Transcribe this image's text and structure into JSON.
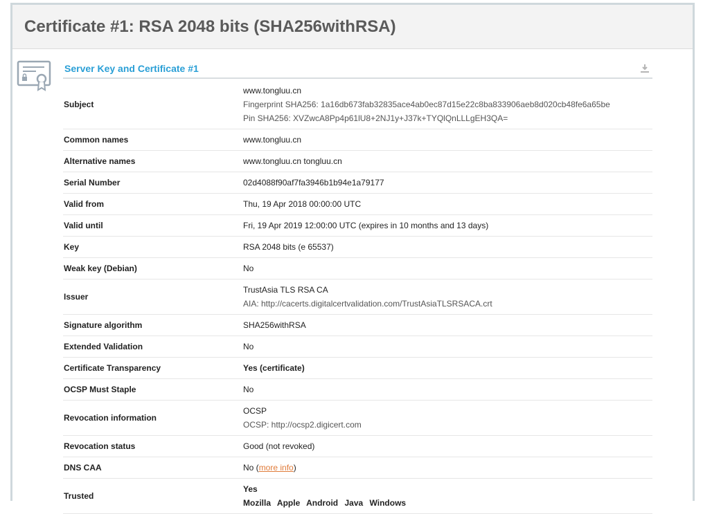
{
  "header": {
    "title": "Certificate #1: RSA 2048 bits (SHA256withRSA)"
  },
  "section": {
    "title": "Server Key and Certificate #1",
    "download_icon": "download-icon"
  },
  "rows": {
    "subject": {
      "label": "Subject",
      "value": "www.tongluu.cn",
      "fingerprint": "Fingerprint SHA256: 1a16db673fab32835ace4ab0ec87d15e22c8ba833906aeb8d020cb48fe6a65be",
      "pin": "Pin SHA256: XVZwcA8Pp4p61lU8+2NJ1y+J37k+TYQlQnLLLgEH3QA="
    },
    "common_names": {
      "label": "Common names",
      "value": "www.tongluu.cn"
    },
    "alt_names": {
      "label": "Alternative names",
      "value": "www.tongluu.cn tongluu.cn"
    },
    "serial": {
      "label": "Serial Number",
      "value": "02d4088f90af7fa3946b1b94e1a79177"
    },
    "valid_from": {
      "label": "Valid from",
      "value": "Thu, 19 Apr 2018 00:00:00 UTC"
    },
    "valid_until": {
      "label": "Valid until",
      "value": "Fri, 19 Apr 2019 12:00:00 UTC (expires in 10 months and 13 days)"
    },
    "key": {
      "label": "Key",
      "value": "RSA 2048 bits (e 65537)"
    },
    "weak_key": {
      "label": "Weak key (Debian)",
      "value": "No"
    },
    "issuer": {
      "label": "Issuer",
      "value": "TrustAsia TLS RSA CA",
      "aia": "AIA: http://cacerts.digitalcertvalidation.com/TrustAsiaTLSRSACA.crt"
    },
    "sig_alg": {
      "label": "Signature algorithm",
      "value": "SHA256withRSA"
    },
    "ev": {
      "label": "Extended Validation",
      "value": "No"
    },
    "ct": {
      "label": "Certificate Transparency",
      "value": "Yes (certificate)"
    },
    "ocsp_staple": {
      "label": "OCSP Must Staple",
      "value": "No"
    },
    "revocation_info": {
      "label": "Revocation information",
      "value": "OCSP",
      "ocsp": "OCSP: http://ocsp2.digicert.com"
    },
    "revocation_status": {
      "label": "Revocation status",
      "value": "Good (not revoked)"
    },
    "dns_caa": {
      "label": "DNS CAA",
      "value": "No",
      "link": "more info"
    },
    "trusted": {
      "label": "Trusted",
      "value": "Yes",
      "stores": [
        "Mozilla",
        "Apple",
        "Android",
        "Java",
        "Windows"
      ]
    }
  },
  "colors": {
    "accent": "#2a9fd6",
    "good": "#1e8a1e",
    "warn": "#e07b39",
    "header_text": "#5a5a5a"
  }
}
